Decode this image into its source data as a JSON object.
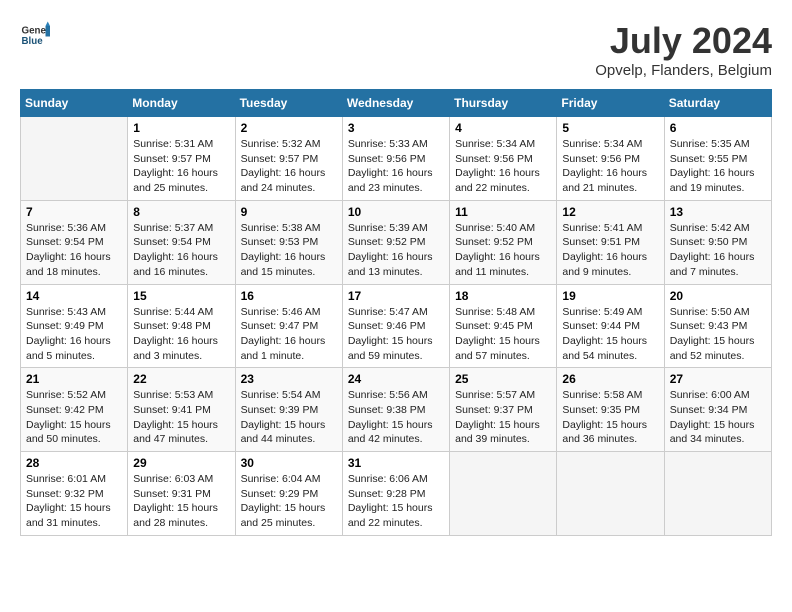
{
  "header": {
    "logo_general": "General",
    "logo_blue": "Blue",
    "month_year": "July 2024",
    "location": "Opvelp, Flanders, Belgium"
  },
  "weekdays": [
    "Sunday",
    "Monday",
    "Tuesday",
    "Wednesday",
    "Thursday",
    "Friday",
    "Saturday"
  ],
  "weeks": [
    [
      {
        "day": "",
        "content": ""
      },
      {
        "day": "1",
        "content": "Sunrise: 5:31 AM\nSunset: 9:57 PM\nDaylight: 16 hours\nand 25 minutes."
      },
      {
        "day": "2",
        "content": "Sunrise: 5:32 AM\nSunset: 9:57 PM\nDaylight: 16 hours\nand 24 minutes."
      },
      {
        "day": "3",
        "content": "Sunrise: 5:33 AM\nSunset: 9:56 PM\nDaylight: 16 hours\nand 23 minutes."
      },
      {
        "day": "4",
        "content": "Sunrise: 5:34 AM\nSunset: 9:56 PM\nDaylight: 16 hours\nand 22 minutes."
      },
      {
        "day": "5",
        "content": "Sunrise: 5:34 AM\nSunset: 9:56 PM\nDaylight: 16 hours\nand 21 minutes."
      },
      {
        "day": "6",
        "content": "Sunrise: 5:35 AM\nSunset: 9:55 PM\nDaylight: 16 hours\nand 19 minutes."
      }
    ],
    [
      {
        "day": "7",
        "content": "Sunrise: 5:36 AM\nSunset: 9:54 PM\nDaylight: 16 hours\nand 18 minutes."
      },
      {
        "day": "8",
        "content": "Sunrise: 5:37 AM\nSunset: 9:54 PM\nDaylight: 16 hours\nand 16 minutes."
      },
      {
        "day": "9",
        "content": "Sunrise: 5:38 AM\nSunset: 9:53 PM\nDaylight: 16 hours\nand 15 minutes."
      },
      {
        "day": "10",
        "content": "Sunrise: 5:39 AM\nSunset: 9:52 PM\nDaylight: 16 hours\nand 13 minutes."
      },
      {
        "day": "11",
        "content": "Sunrise: 5:40 AM\nSunset: 9:52 PM\nDaylight: 16 hours\nand 11 minutes."
      },
      {
        "day": "12",
        "content": "Sunrise: 5:41 AM\nSunset: 9:51 PM\nDaylight: 16 hours\nand 9 minutes."
      },
      {
        "day": "13",
        "content": "Sunrise: 5:42 AM\nSunset: 9:50 PM\nDaylight: 16 hours\nand 7 minutes."
      }
    ],
    [
      {
        "day": "14",
        "content": "Sunrise: 5:43 AM\nSunset: 9:49 PM\nDaylight: 16 hours\nand 5 minutes."
      },
      {
        "day": "15",
        "content": "Sunrise: 5:44 AM\nSunset: 9:48 PM\nDaylight: 16 hours\nand 3 minutes."
      },
      {
        "day": "16",
        "content": "Sunrise: 5:46 AM\nSunset: 9:47 PM\nDaylight: 16 hours\nand 1 minute."
      },
      {
        "day": "17",
        "content": "Sunrise: 5:47 AM\nSunset: 9:46 PM\nDaylight: 15 hours\nand 59 minutes."
      },
      {
        "day": "18",
        "content": "Sunrise: 5:48 AM\nSunset: 9:45 PM\nDaylight: 15 hours\nand 57 minutes."
      },
      {
        "day": "19",
        "content": "Sunrise: 5:49 AM\nSunset: 9:44 PM\nDaylight: 15 hours\nand 54 minutes."
      },
      {
        "day": "20",
        "content": "Sunrise: 5:50 AM\nSunset: 9:43 PM\nDaylight: 15 hours\nand 52 minutes."
      }
    ],
    [
      {
        "day": "21",
        "content": "Sunrise: 5:52 AM\nSunset: 9:42 PM\nDaylight: 15 hours\nand 50 minutes."
      },
      {
        "day": "22",
        "content": "Sunrise: 5:53 AM\nSunset: 9:41 PM\nDaylight: 15 hours\nand 47 minutes."
      },
      {
        "day": "23",
        "content": "Sunrise: 5:54 AM\nSunset: 9:39 PM\nDaylight: 15 hours\nand 44 minutes."
      },
      {
        "day": "24",
        "content": "Sunrise: 5:56 AM\nSunset: 9:38 PM\nDaylight: 15 hours\nand 42 minutes."
      },
      {
        "day": "25",
        "content": "Sunrise: 5:57 AM\nSunset: 9:37 PM\nDaylight: 15 hours\nand 39 minutes."
      },
      {
        "day": "26",
        "content": "Sunrise: 5:58 AM\nSunset: 9:35 PM\nDaylight: 15 hours\nand 36 minutes."
      },
      {
        "day": "27",
        "content": "Sunrise: 6:00 AM\nSunset: 9:34 PM\nDaylight: 15 hours\nand 34 minutes."
      }
    ],
    [
      {
        "day": "28",
        "content": "Sunrise: 6:01 AM\nSunset: 9:32 PM\nDaylight: 15 hours\nand 31 minutes."
      },
      {
        "day": "29",
        "content": "Sunrise: 6:03 AM\nSunset: 9:31 PM\nDaylight: 15 hours\nand 28 minutes."
      },
      {
        "day": "30",
        "content": "Sunrise: 6:04 AM\nSunset: 9:29 PM\nDaylight: 15 hours\nand 25 minutes."
      },
      {
        "day": "31",
        "content": "Sunrise: 6:06 AM\nSunset: 9:28 PM\nDaylight: 15 hours\nand 22 minutes."
      },
      {
        "day": "",
        "content": ""
      },
      {
        "day": "",
        "content": ""
      },
      {
        "day": "",
        "content": ""
      }
    ]
  ]
}
